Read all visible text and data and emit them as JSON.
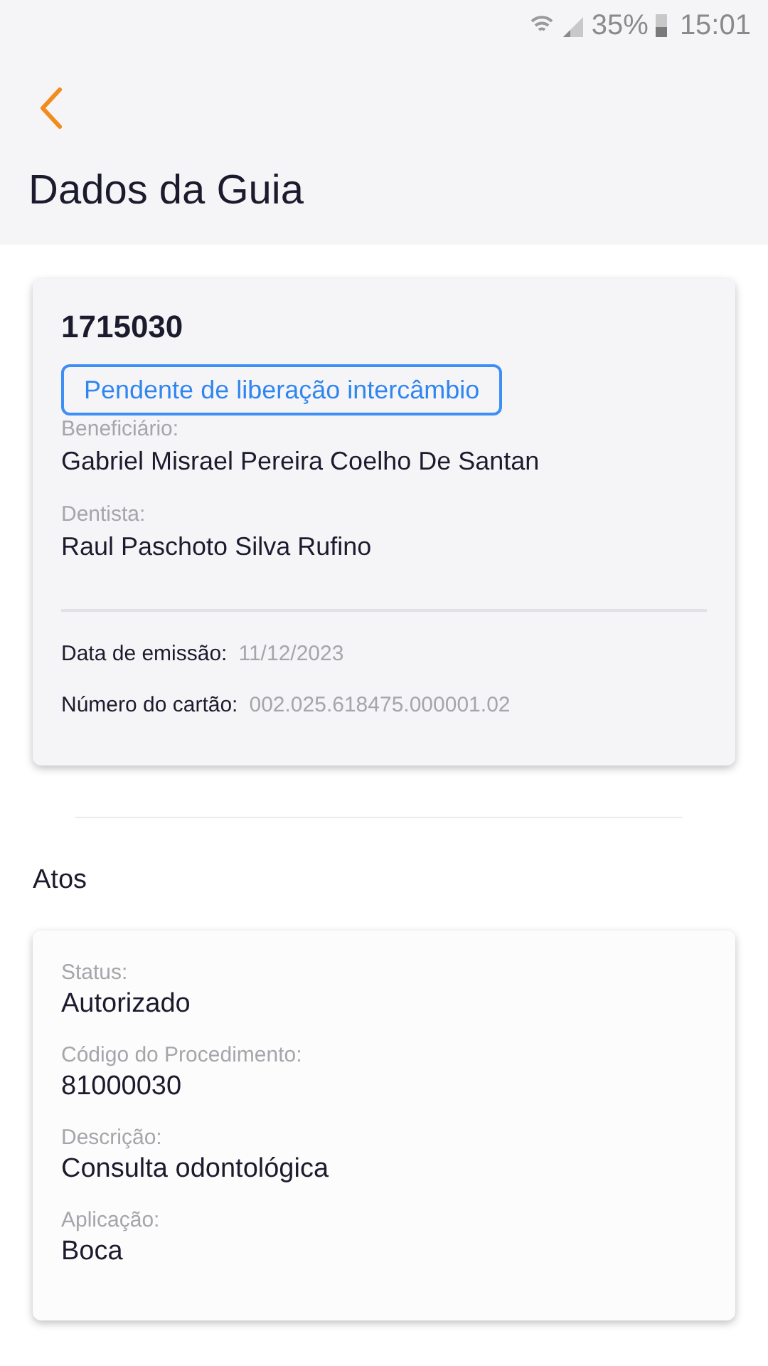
{
  "status_bar": {
    "battery": "35%",
    "time": "15:01"
  },
  "header": {
    "title": "Dados da Guia"
  },
  "guide": {
    "number": "1715030",
    "badge": "Pendente de liberação intercâmbio",
    "fields": [
      {
        "label": "Beneficiário:",
        "value": "Gabriel Misrael Pereira Coelho De Santan"
      },
      {
        "label": "Dentista:",
        "value": "Raul Paschoto Silva Rufino"
      }
    ],
    "details": [
      {
        "label": "Data de emissão:",
        "value": "11/12/2023"
      },
      {
        "label": "Número do cartão:",
        "value": "002.025.618475.000001.02"
      }
    ]
  },
  "section_title": "Atos",
  "acts": [
    {
      "fields": [
        {
          "label": "Status:",
          "value": "Autorizado"
        },
        {
          "label": "Código do Procedimento:",
          "value": "81000030"
        },
        {
          "label": "Descrição:",
          "value": "Consulta odontológica"
        },
        {
          "label": "Aplicação:",
          "value": "Boca"
        }
      ]
    }
  ]
}
